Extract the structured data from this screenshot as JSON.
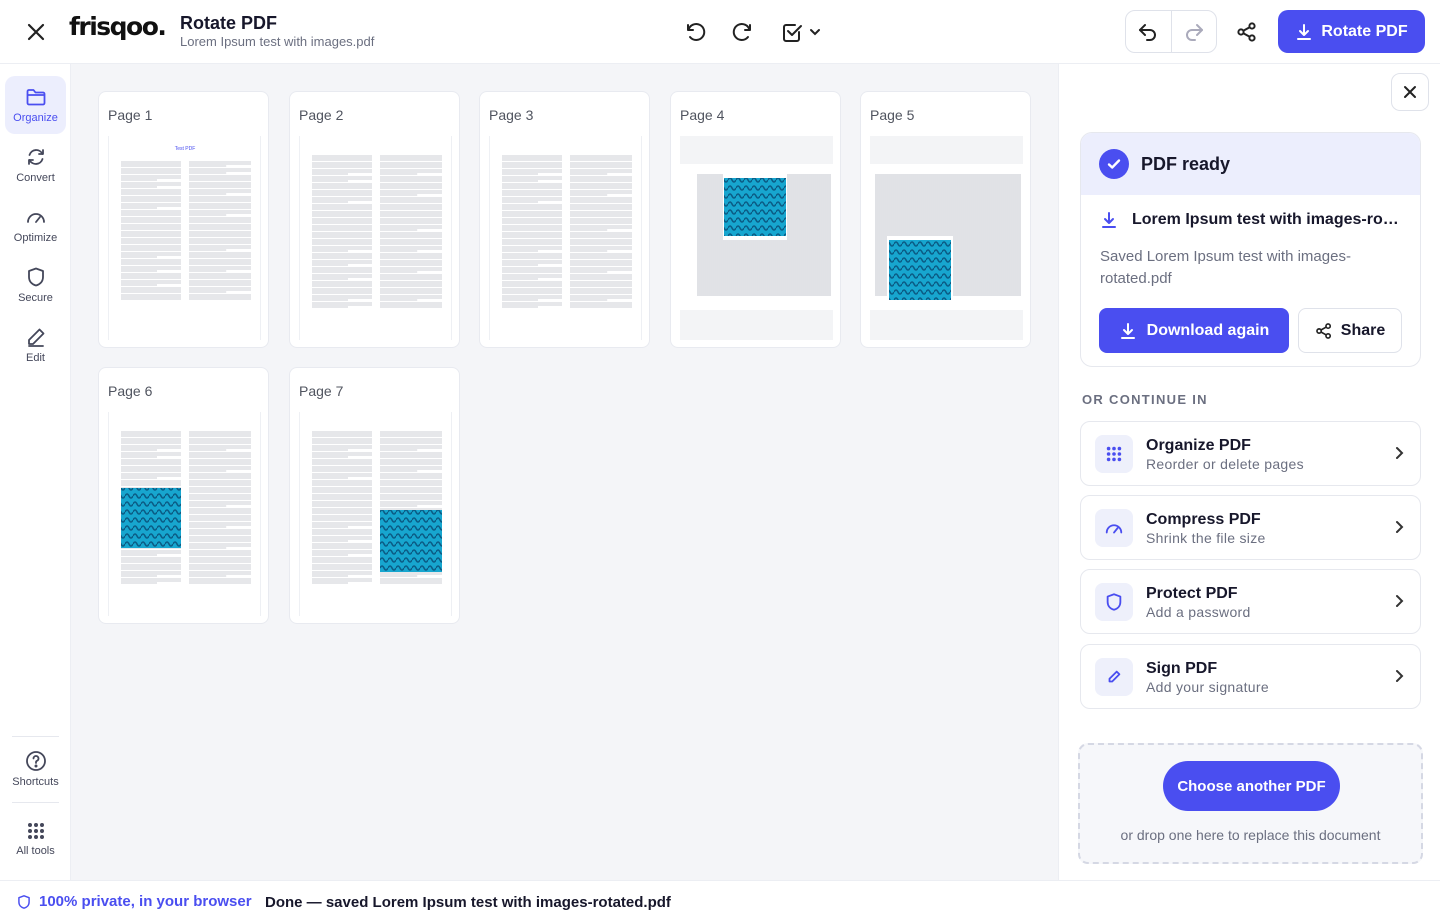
{
  "header": {
    "close_icon": "close-icon",
    "logo": "frisqoo.",
    "title": "Rotate PDF",
    "filename": "Lorem Ipsum test with images.pdf",
    "rotate_left_icon": "rotate-ccw-icon",
    "rotate_right_icon": "rotate-cw-icon",
    "select_icon": "checkbox-select-icon",
    "undo_icon": "undo-icon",
    "redo_icon": "redo-icon",
    "share_icon": "share-icon",
    "primary_button": "Rotate PDF"
  },
  "rail": {
    "items": [
      {
        "label": "Organize",
        "icon": "folder-icon",
        "active": true
      },
      {
        "label": "Convert",
        "icon": "refresh-icon"
      },
      {
        "label": "Optimize",
        "icon": "gauge-icon"
      },
      {
        "label": "Secure",
        "icon": "shield-icon"
      },
      {
        "label": "Edit",
        "icon": "pencil-icon"
      }
    ],
    "shortcuts": "Shortcuts",
    "all_tools": "All tools"
  },
  "pages": [
    {
      "label": "Page 1",
      "heading": "Test PDF"
    },
    {
      "label": "Page 2"
    },
    {
      "label": "Page 3"
    },
    {
      "label": "Page 4"
    },
    {
      "label": "Page 5"
    },
    {
      "label": "Page 6"
    },
    {
      "label": "Page 7"
    }
  ],
  "panel": {
    "ready_title": "PDF ready",
    "file_name": "Lorem Ipsum test with images-rotated.pdf",
    "saved_note": "Saved Lorem Ipsum test with images-rotated.pdf",
    "download_again": "Download again",
    "share": "Share",
    "continue_label": "OR CONTINUE IN",
    "tools": [
      {
        "name": "Organize PDF",
        "desc": "Reorder or delete pages",
        "icon": "grid-dots-icon"
      },
      {
        "name": "Compress PDF",
        "desc": "Shrink the file size",
        "icon": "gauge-icon"
      },
      {
        "name": "Protect PDF",
        "desc": "Add a password",
        "icon": "shield-icon"
      },
      {
        "name": "Sign PDF",
        "desc": "Add your signature",
        "icon": "pen-icon"
      }
    ],
    "choose_another": "Choose another PDF",
    "drop_hint": "or drop one here to replace this document"
  },
  "status": {
    "privacy": "100% private, in your browser",
    "message": "Done — saved Lorem Ipsum test with images-rotated.pdf"
  },
  "colors": {
    "accent": "#4a4ef0",
    "accent_soft": "#eceefd",
    "pattern": "#1aa0c8"
  }
}
